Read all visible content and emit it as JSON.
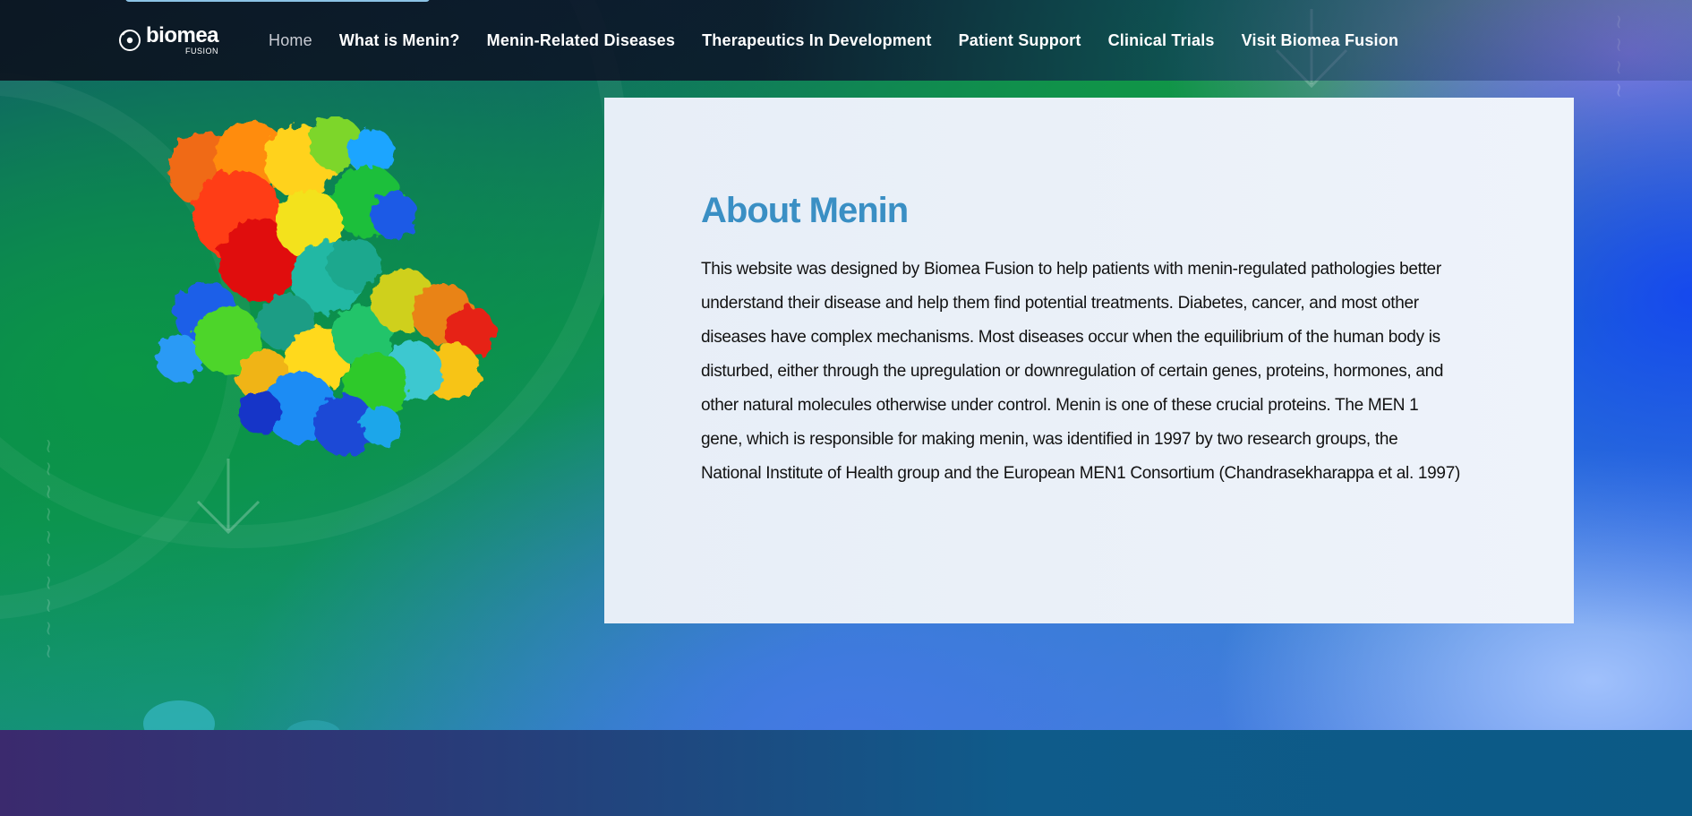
{
  "brand": {
    "name": "biomea",
    "sub": "FUSION"
  },
  "nav": {
    "items": [
      {
        "label": "Home"
      },
      {
        "label": "What is Menin?"
      },
      {
        "label": "Menin-Related Diseases"
      },
      {
        "label": "Therapeutics In Development"
      },
      {
        "label": "Patient Support"
      },
      {
        "label": "Clinical Trials"
      },
      {
        "label": "Visit Biomea Fusion"
      }
    ]
  },
  "about": {
    "title": "About Menin",
    "body": "This website was designed by Biomea Fusion to help patients with menin-regulated pathologies better understand their disease and help them find potential treatments. Diabetes, cancer, and most other diseases have complex mechanisms. Most diseases occur when the equilibrium of the human body is disturbed, either through the upregulation or downregulation of certain genes, proteins, hormones, and other natural molecules otherwise under control. Menin is one of these crucial proteins. The  MEN 1  gene, which is responsible for making menin, was identified in 1997 by two research groups, the National Institute of Health group and the European MEN1 Consortium (Chandrasekharappa et al. 1997)"
  },
  "colors": {
    "accent": "#3a8fc4",
    "card_bg": "#eaf0f8",
    "footer": "#0b5a86"
  },
  "icons": {
    "logo": "biomea-logo-icon",
    "scroll": "down-arrow-icon"
  }
}
